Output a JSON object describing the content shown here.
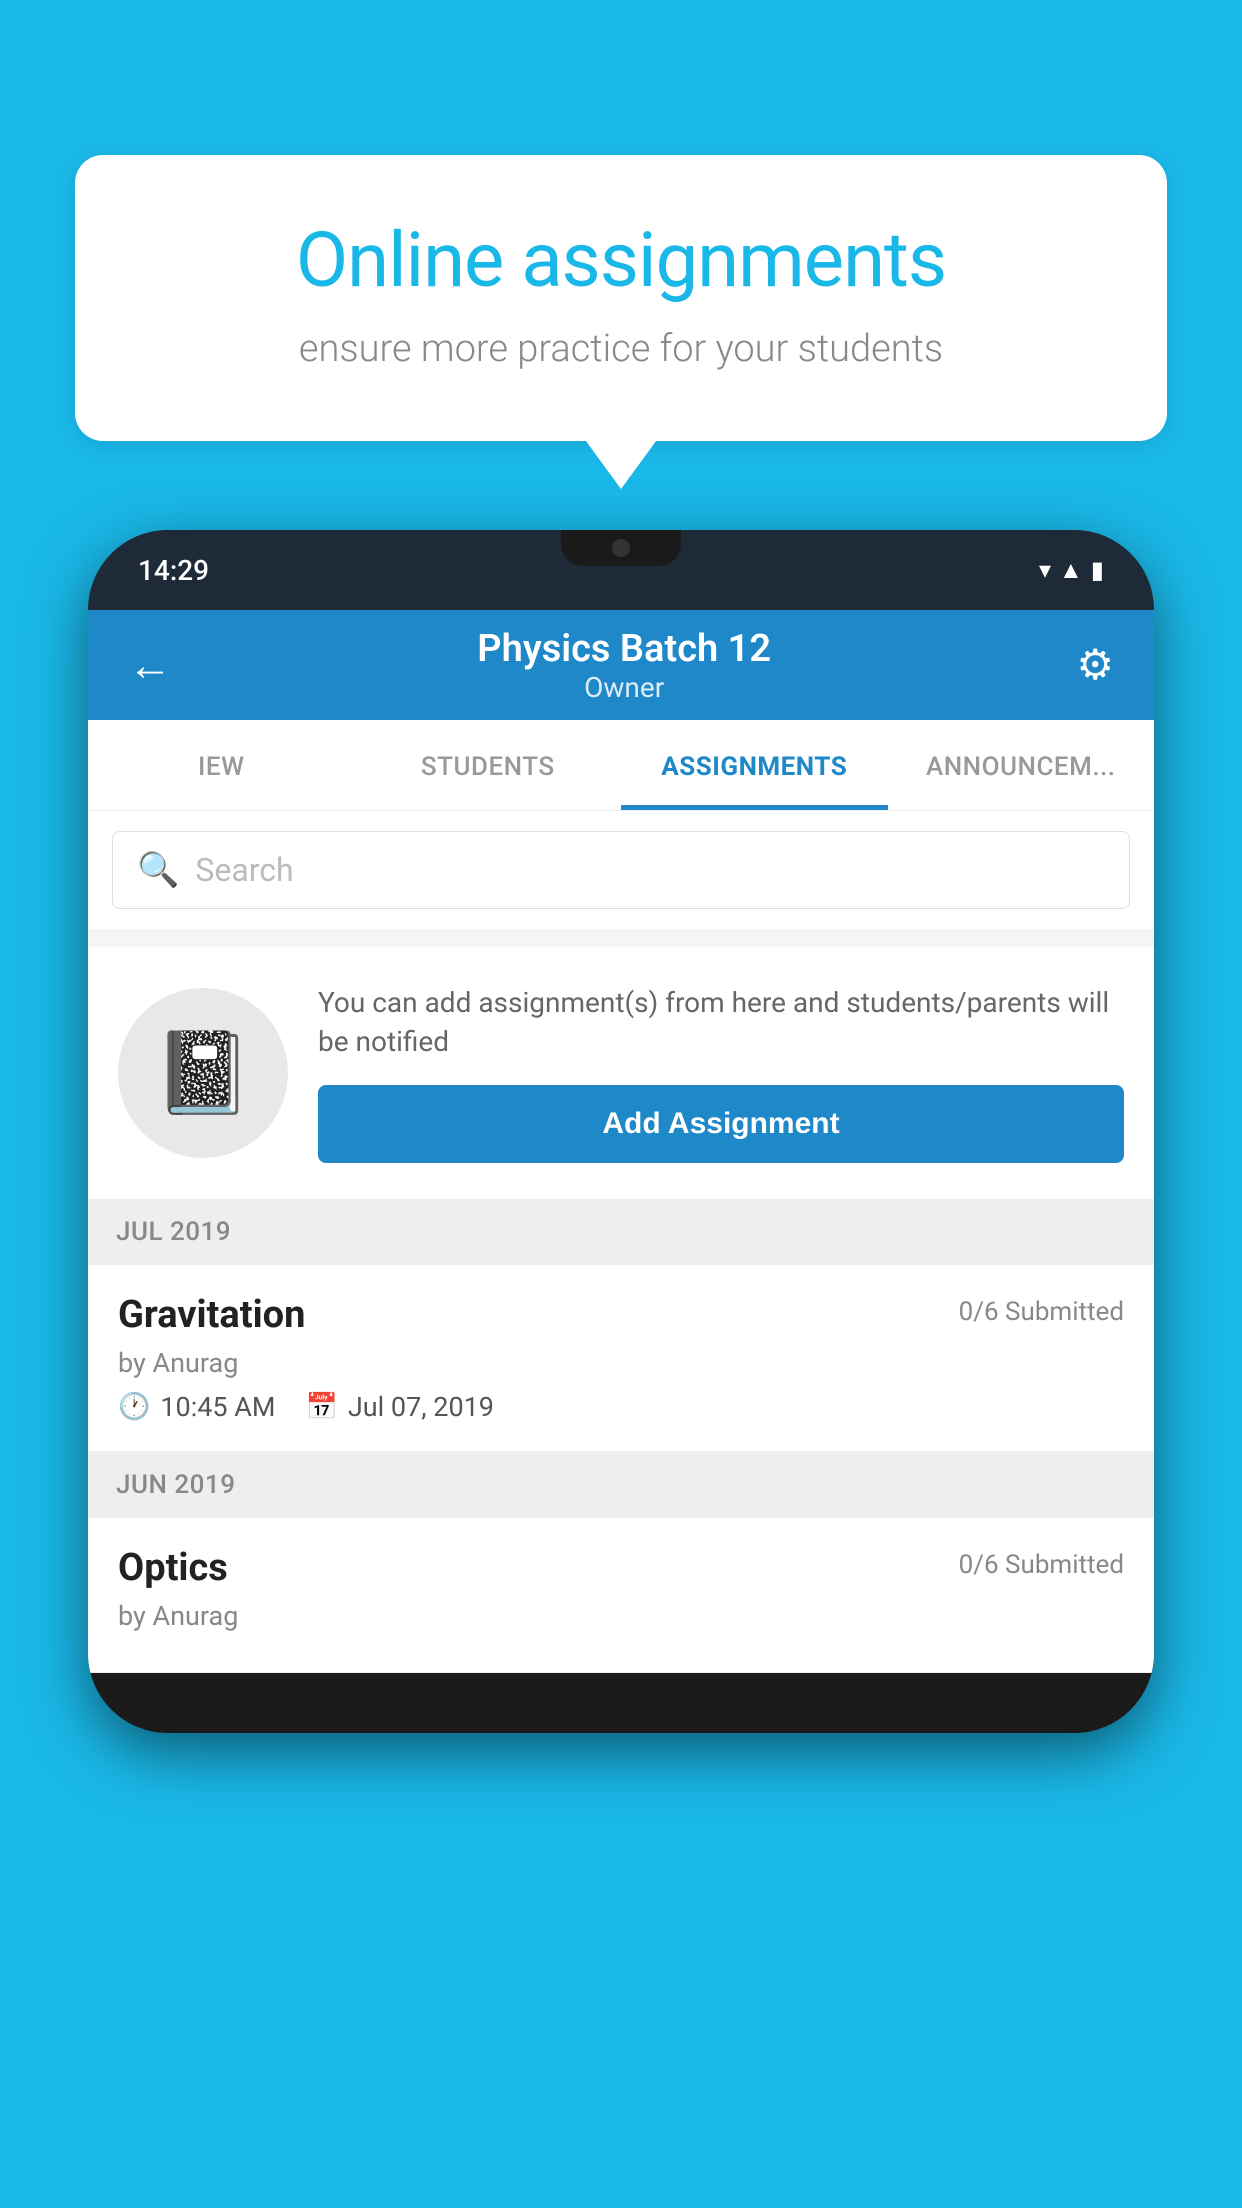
{
  "background_color": "#1ab8e8",
  "speech_bubble": {
    "title": "Online assignments",
    "subtitle": "ensure more practice for your students"
  },
  "phone": {
    "status_bar": {
      "time": "14:29",
      "icons": [
        "wifi",
        "signal",
        "battery"
      ]
    },
    "app_bar": {
      "title": "Physics Batch 12",
      "subtitle": "Owner",
      "back_label": "←",
      "gear_label": "⚙"
    },
    "tabs": [
      {
        "label": "IEW",
        "active": false
      },
      {
        "label": "STUDENTS",
        "active": false
      },
      {
        "label": "ASSIGNMENTS",
        "active": true
      },
      {
        "label": "ANNOUNCEM...",
        "active": false
      }
    ],
    "search": {
      "placeholder": "Search"
    },
    "promo_card": {
      "text": "You can add assignment(s) from here and students/parents will be notified",
      "button_label": "Add Assignment"
    },
    "sections": [
      {
        "month": "JUL 2019",
        "assignments": [
          {
            "title": "Gravitation",
            "submitted": "0/6 Submitted",
            "by": "by Anurag",
            "time": "10:45 AM",
            "date": "Jul 07, 2019"
          }
        ]
      },
      {
        "month": "JUN 2019",
        "assignments": [
          {
            "title": "Optics",
            "submitted": "0/6 Submitted",
            "by": "by Anurag",
            "time": "",
            "date": ""
          }
        ]
      }
    ]
  }
}
